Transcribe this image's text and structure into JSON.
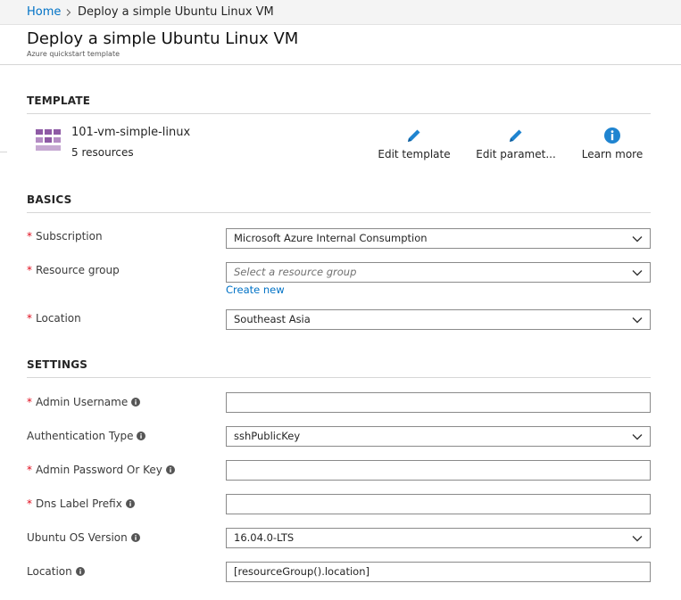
{
  "breadcrumb": {
    "home": "Home",
    "current": "Deploy a simple Ubuntu Linux VM"
  },
  "header": {
    "title": "Deploy a simple Ubuntu Linux VM",
    "subtitle": "Azure quickstart template"
  },
  "colors": {
    "accent_link": "#0072c6",
    "required_asterisk": "#e00b1c",
    "template_icon": "#8e5aa5",
    "action_icon": "#1f84d0"
  },
  "template": {
    "heading": "TEMPLATE",
    "name": "101-vm-simple-linux",
    "resources": "5 resources",
    "actions": [
      {
        "label": "Edit template",
        "icon": "pencil-icon"
      },
      {
        "label": "Edit paramet...",
        "icon": "pencil-icon"
      },
      {
        "label": "Learn more",
        "icon": "info-icon"
      }
    ]
  },
  "basics": {
    "heading": "BASICS",
    "required_mark": "*",
    "subscription": {
      "label": "Subscription",
      "value": "Microsoft Azure Internal Consumption"
    },
    "resource_group": {
      "label": "Resource group",
      "placeholder": "Select a resource group",
      "create_new": "Create new"
    },
    "location": {
      "label": "Location",
      "value": "Southeast Asia"
    }
  },
  "settings": {
    "heading": "SETTINGS",
    "admin_username": {
      "label": "Admin Username",
      "value": ""
    },
    "auth_type": {
      "label": "Authentication Type",
      "value": "sshPublicKey"
    },
    "admin_password": {
      "label": "Admin Password Or Key",
      "value": ""
    },
    "dns_label": {
      "label": "Dns Label Prefix",
      "value": ""
    },
    "ubuntu_version": {
      "label": "Ubuntu OS Version",
      "value": "16.04.0-LTS"
    },
    "location": {
      "label": "Location",
      "value": "[resourceGroup().location]"
    }
  }
}
